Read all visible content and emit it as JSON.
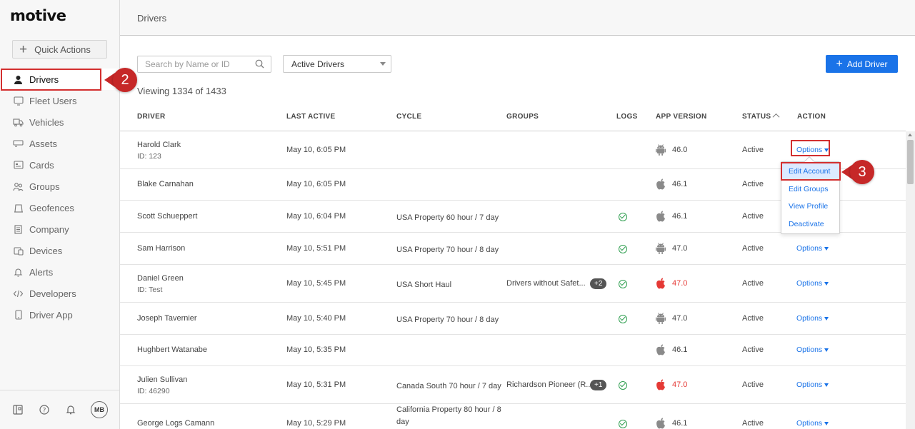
{
  "app": {
    "logo": "motive",
    "page_title": "Drivers"
  },
  "sidebar": {
    "quick_actions_label": "Quick Actions",
    "items": [
      {
        "label": "Drivers",
        "icon": "person-icon",
        "active": true
      },
      {
        "label": "Fleet Users",
        "icon": "monitor-icon"
      },
      {
        "label": "Vehicles",
        "icon": "truck-icon"
      },
      {
        "label": "Assets",
        "icon": "trailer-icon"
      },
      {
        "label": "Cards",
        "icon": "card-icon"
      },
      {
        "label": "Groups",
        "icon": "groups-icon"
      },
      {
        "label": "Geofences",
        "icon": "geofence-icon"
      },
      {
        "label": "Company",
        "icon": "building-icon"
      },
      {
        "label": "Devices",
        "icon": "devices-icon"
      },
      {
        "label": "Alerts",
        "icon": "bell-icon"
      },
      {
        "label": "Developers",
        "icon": "code-icon"
      },
      {
        "label": "Driver App",
        "icon": "phone-icon"
      }
    ],
    "footer": {
      "avatar_initials": "MB"
    }
  },
  "toolbar": {
    "search_placeholder": "Search by Name or ID",
    "filter_value": "Active Drivers",
    "add_driver_label": "Add Driver",
    "viewing_text": "Viewing 1334 of 1433"
  },
  "table": {
    "columns": {
      "driver": "DRIVER",
      "last_active": "LAST ACTIVE",
      "cycle": "CYCLE",
      "groups": "GROUPS",
      "logs": "LOGS",
      "app_version": "APP VERSION",
      "status": "STATUS",
      "action": "ACTION"
    },
    "options_label": "Options",
    "rows": [
      {
        "name": "Harold Clark",
        "id": "ID: 123",
        "last_active": "May 10, 6:05 PM",
        "cycle": "",
        "groups": "",
        "badge": "",
        "logs": false,
        "platform": "android",
        "version": "46.0",
        "outdated": false,
        "status": "Active"
      },
      {
        "name": "Blake Carnahan",
        "id": "",
        "last_active": "May 10, 6:05 PM",
        "cycle": "",
        "groups": "",
        "badge": "",
        "logs": false,
        "platform": "ios",
        "version": "46.1",
        "outdated": false,
        "status": "Active"
      },
      {
        "name": "Scott Schueppert",
        "id": "",
        "last_active": "May 10, 6:04 PM",
        "cycle": "USA Property 60 hour / 7 day",
        "groups": "",
        "badge": "",
        "logs": true,
        "platform": "ios",
        "version": "46.1",
        "outdated": false,
        "status": "Active"
      },
      {
        "name": "Sam Harrison",
        "id": "",
        "last_active": "May 10, 5:51 PM",
        "cycle": "USA Property 70 hour / 8 day",
        "groups": "",
        "badge": "",
        "logs": true,
        "platform": "android",
        "version": "47.0",
        "outdated": false,
        "status": "Active"
      },
      {
        "name": "Daniel Green",
        "id": "ID: Test",
        "last_active": "May 10, 5:45 PM",
        "cycle": "USA Short Haul",
        "groups": "Drivers without Safet...",
        "badge": "+2",
        "logs": true,
        "platform": "ios",
        "version": "47.0",
        "outdated": true,
        "status": "Active"
      },
      {
        "name": "Joseph Tavernier",
        "id": "",
        "last_active": "May 10, 5:40 PM",
        "cycle": "USA Property 70 hour / 8 day",
        "groups": "",
        "badge": "",
        "logs": true,
        "platform": "android",
        "version": "47.0",
        "outdated": false,
        "status": "Active"
      },
      {
        "name": "Hughbert Watanabe",
        "id": "",
        "last_active": "May 10, 5:35 PM",
        "cycle": "",
        "groups": "",
        "badge": "",
        "logs": false,
        "platform": "ios",
        "version": "46.1",
        "outdated": false,
        "status": "Active"
      },
      {
        "name": "Julien Sullivan",
        "id": "ID: 46290",
        "last_active": "May 10, 5:31 PM",
        "cycle": "Canada South 70 hour / 7 day",
        "groups": "Richardson Pioneer (R...",
        "badge": "+1",
        "logs": true,
        "platform": "ios",
        "version": "47.0",
        "outdated": true,
        "status": "Active"
      },
      {
        "name": "George Logs Camann",
        "id": "",
        "last_active": "May 10, 5:29 PM",
        "cycle": "California Property 80 hour / 8 day",
        "groups": "",
        "badge": "",
        "logs": true,
        "platform": "ios",
        "version": "46.1",
        "outdated": false,
        "status": "Active"
      }
    ]
  },
  "dropdown": {
    "items": [
      "Edit Account",
      "Edit Groups",
      "View Profile",
      "Deactivate"
    ],
    "active_index": 0
  },
  "callouts": {
    "step_sidebar": "2",
    "step_dropdown": "3"
  },
  "colors": {
    "accent": "#1a73e8",
    "callout": "#c62828",
    "outdated": "#e53935",
    "logs_ok": "#2e9e4f"
  }
}
